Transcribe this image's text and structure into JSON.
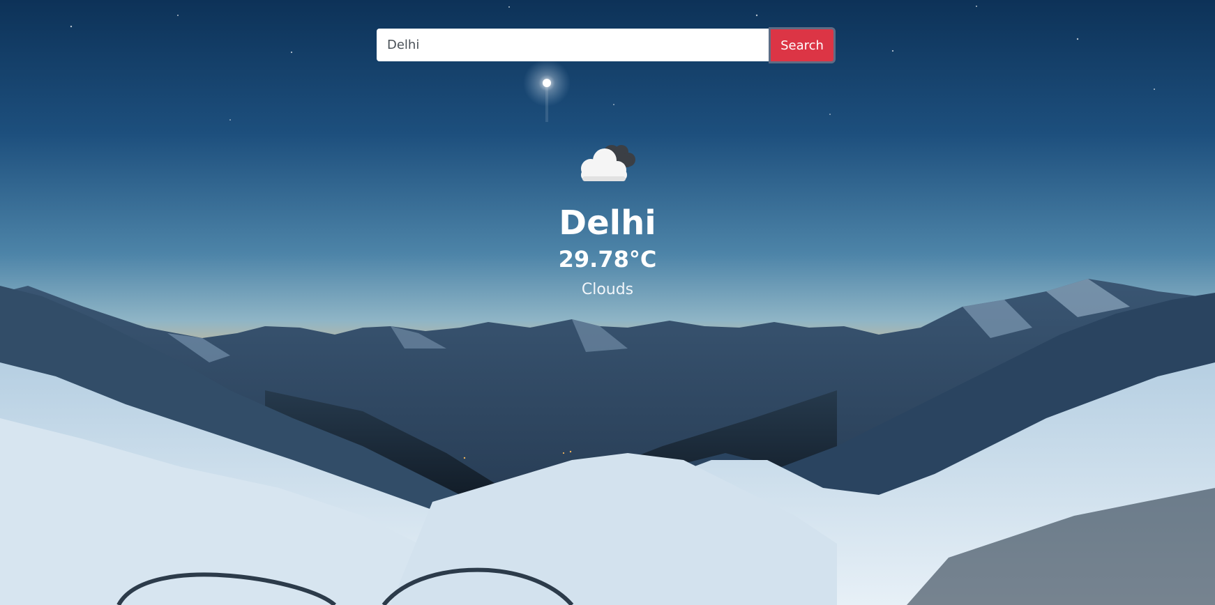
{
  "search": {
    "value": "Delhi",
    "button_label": "Search"
  },
  "weather": {
    "icon": "clouds-icon",
    "city": "Delhi",
    "temperature": "29.78°C",
    "condition": "Clouds"
  },
  "colors": {
    "search_button": "#dc3545",
    "search_button_border": "#5f6c85",
    "text": "#ffffff"
  }
}
